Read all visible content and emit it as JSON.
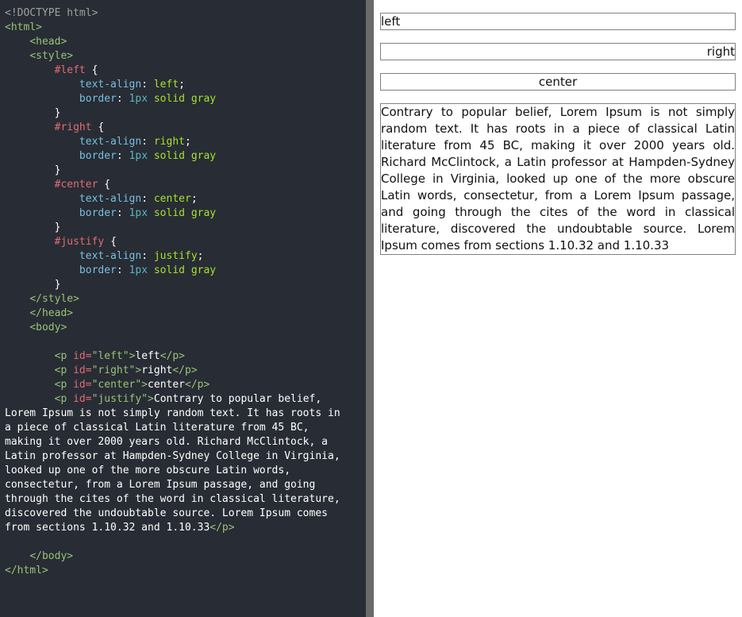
{
  "editor": {
    "lines": [
      [
        {
          "t": "doctype",
          "v": "<!DOCTYPE html>"
        }
      ],
      [
        {
          "t": "tag",
          "v": "<html>"
        }
      ],
      [
        {
          "t": "text",
          "v": "    "
        },
        {
          "t": "tag",
          "v": "<head>"
        }
      ],
      [
        {
          "t": "text",
          "v": "    "
        },
        {
          "t": "tag",
          "v": "<style>"
        }
      ],
      [
        {
          "t": "text",
          "v": "        "
        },
        {
          "t": "sel",
          "v": "#left"
        },
        {
          "t": "punc",
          "v": " {"
        }
      ],
      [
        {
          "t": "text",
          "v": "            "
        },
        {
          "t": "prop",
          "v": "text-align"
        },
        {
          "t": "punc",
          "v": ": "
        },
        {
          "t": "val",
          "v": "left"
        },
        {
          "t": "punc",
          "v": ";"
        }
      ],
      [
        {
          "t": "text",
          "v": "            "
        },
        {
          "t": "prop",
          "v": "border"
        },
        {
          "t": "punc",
          "v": ": "
        },
        {
          "t": "num",
          "v": "1px"
        },
        {
          "t": "punc",
          "v": " "
        },
        {
          "t": "val",
          "v": "solid gray"
        }
      ],
      [
        {
          "t": "text",
          "v": "        "
        },
        {
          "t": "punc",
          "v": "}"
        }
      ],
      [
        {
          "t": "text",
          "v": "        "
        },
        {
          "t": "sel",
          "v": "#right"
        },
        {
          "t": "punc",
          "v": " {"
        }
      ],
      [
        {
          "t": "text",
          "v": "            "
        },
        {
          "t": "prop",
          "v": "text-align"
        },
        {
          "t": "punc",
          "v": ": "
        },
        {
          "t": "val",
          "v": "right"
        },
        {
          "t": "punc",
          "v": ";"
        }
      ],
      [
        {
          "t": "text",
          "v": "            "
        },
        {
          "t": "prop",
          "v": "border"
        },
        {
          "t": "punc",
          "v": ": "
        },
        {
          "t": "num",
          "v": "1px"
        },
        {
          "t": "punc",
          "v": " "
        },
        {
          "t": "val",
          "v": "solid gray"
        }
      ],
      [
        {
          "t": "text",
          "v": "        "
        },
        {
          "t": "punc",
          "v": "}"
        }
      ],
      [
        {
          "t": "text",
          "v": "        "
        },
        {
          "t": "sel",
          "v": "#center"
        },
        {
          "t": "punc",
          "v": " {"
        }
      ],
      [
        {
          "t": "text",
          "v": "            "
        },
        {
          "t": "prop",
          "v": "text-align"
        },
        {
          "t": "punc",
          "v": ": "
        },
        {
          "t": "val",
          "v": "center"
        },
        {
          "t": "punc",
          "v": ";"
        }
      ],
      [
        {
          "t": "text",
          "v": "            "
        },
        {
          "t": "prop",
          "v": "border"
        },
        {
          "t": "punc",
          "v": ": "
        },
        {
          "t": "num",
          "v": "1px"
        },
        {
          "t": "punc",
          "v": " "
        },
        {
          "t": "val",
          "v": "solid gray"
        }
      ],
      [
        {
          "t": "text",
          "v": "        "
        },
        {
          "t": "punc",
          "v": "}"
        }
      ],
      [
        {
          "t": "text",
          "v": "        "
        },
        {
          "t": "sel",
          "v": "#justify"
        },
        {
          "t": "punc",
          "v": " {"
        }
      ],
      [
        {
          "t": "text",
          "v": "            "
        },
        {
          "t": "prop",
          "v": "text-align"
        },
        {
          "t": "punc",
          "v": ": "
        },
        {
          "t": "val",
          "v": "justify"
        },
        {
          "t": "punc",
          "v": ";"
        }
      ],
      [
        {
          "t": "text",
          "v": "            "
        },
        {
          "t": "prop",
          "v": "border"
        },
        {
          "t": "punc",
          "v": ": "
        },
        {
          "t": "num",
          "v": "1px"
        },
        {
          "t": "punc",
          "v": " "
        },
        {
          "t": "val",
          "v": "solid gray"
        }
      ],
      [
        {
          "t": "text",
          "v": "        "
        },
        {
          "t": "punc",
          "v": "}"
        }
      ],
      [
        {
          "t": "text",
          "v": "    "
        },
        {
          "t": "tag",
          "v": "</style>"
        }
      ],
      [
        {
          "t": "text",
          "v": "    "
        },
        {
          "t": "tag",
          "v": "</head>"
        }
      ],
      [
        {
          "t": "text",
          "v": "    "
        },
        {
          "t": "tag",
          "v": "<body>"
        }
      ],
      [
        {
          "t": "text",
          "v": ""
        }
      ],
      [
        {
          "t": "text",
          "v": "        "
        },
        {
          "t": "tag",
          "v": "<p "
        },
        {
          "t": "attr",
          "v": "id="
        },
        {
          "t": "str",
          "v": "\"left\""
        },
        {
          "t": "tag",
          "v": ">"
        },
        {
          "t": "text",
          "v": "left"
        },
        {
          "t": "tag",
          "v": "</p>"
        }
      ],
      [
        {
          "t": "text",
          "v": "        "
        },
        {
          "t": "tag",
          "v": "<p "
        },
        {
          "t": "attr",
          "v": "id="
        },
        {
          "t": "str",
          "v": "\"right\""
        },
        {
          "t": "tag",
          "v": ">"
        },
        {
          "t": "text",
          "v": "right"
        },
        {
          "t": "tag",
          "v": "</p>"
        }
      ],
      [
        {
          "t": "text",
          "v": "        "
        },
        {
          "t": "tag",
          "v": "<p "
        },
        {
          "t": "attr",
          "v": "id="
        },
        {
          "t": "str",
          "v": "\"center\""
        },
        {
          "t": "tag",
          "v": ">"
        },
        {
          "t": "text",
          "v": "center"
        },
        {
          "t": "tag",
          "v": "</p>"
        }
      ],
      [
        {
          "t": "text",
          "v": "        "
        },
        {
          "t": "tag",
          "v": "<p "
        },
        {
          "t": "attr",
          "v": "id="
        },
        {
          "t": "str",
          "v": "\"justify\""
        },
        {
          "t": "tag",
          "v": ">"
        },
        {
          "t": "text",
          "v": "Contrary to popular belief,"
        }
      ],
      [
        {
          "t": "text",
          "v": "Lorem Ipsum is not simply random text. It has roots in"
        }
      ],
      [
        {
          "t": "text",
          "v": "a piece of classical Latin literature from 45 BC,"
        }
      ],
      [
        {
          "t": "text",
          "v": "making it over 2000 years old. Richard McClintock, a"
        }
      ],
      [
        {
          "t": "text",
          "v": "Latin professor at Hampden-Sydney College in Virginia,"
        }
      ],
      [
        {
          "t": "text",
          "v": "looked up one of the more obscure Latin words,"
        }
      ],
      [
        {
          "t": "text",
          "v": "consectetur, from a Lorem Ipsum passage, and going"
        }
      ],
      [
        {
          "t": "text",
          "v": "through the cites of the word in classical literature,"
        }
      ],
      [
        {
          "t": "text",
          "v": "discovered the undoubtable source. Lorem Ipsum comes"
        }
      ],
      [
        {
          "t": "text",
          "v": "from sections 1.10.32 and 1.10.33"
        },
        {
          "t": "tag",
          "v": "</p>"
        }
      ],
      [
        {
          "t": "text",
          "v": ""
        }
      ],
      [
        {
          "t": "text",
          "v": "    "
        },
        {
          "t": "tag",
          "v": "</body>"
        }
      ],
      [
        {
          "t": "tag",
          "v": "</html>"
        }
      ]
    ]
  },
  "preview": {
    "left": "left",
    "right": "right",
    "center": "center",
    "justify": "Contrary to popular belief, Lorem Ipsum is not simply random text. It has roots in a piece of classical Latin literature from 45 BC, making it over 2000 years old. Richard McClintock, a Latin professor at Hampden-Sydney College in Virginia, looked up one of the more obscure Latin words, consectetur, from a Lorem Ipsum passage, and going through the cites of the word in classical literature, discovered the undoubtable source. Lorem Ipsum comes from sections 1.10.32 and 1.10.33"
  },
  "colors": {
    "editor_background": "#282c34",
    "divider": "#6b6b6b",
    "preview_background": "#ffffff",
    "border": "gray"
  }
}
